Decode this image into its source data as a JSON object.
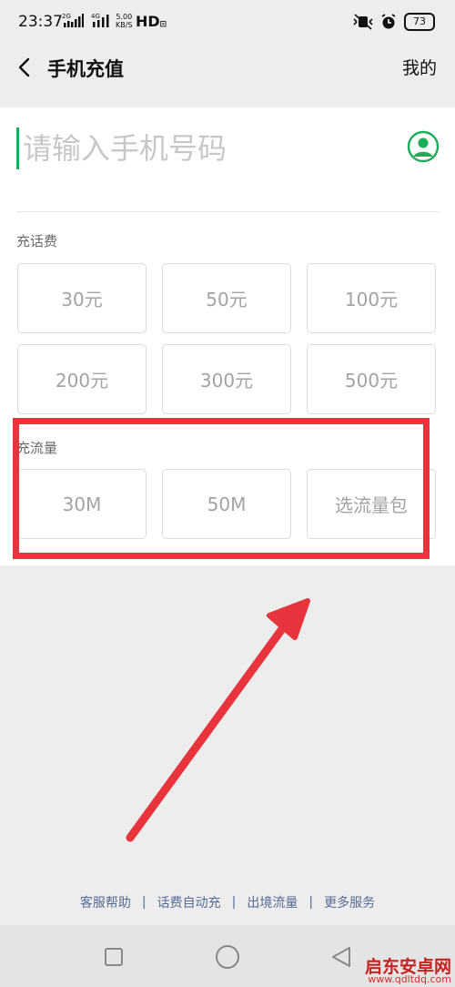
{
  "status_bar": {
    "time": "23:37",
    "signal1_label": "2G",
    "signal2_label": "4G",
    "speed_value": "5.00",
    "speed_unit": "KB/S",
    "hd_label": "HD",
    "battery": "73"
  },
  "header": {
    "title": "手机充值",
    "mine": "我的"
  },
  "phone": {
    "placeholder": "请输入手机号码"
  },
  "recharge": {
    "label": "充话费",
    "options": [
      "30元",
      "50元",
      "100元",
      "200元",
      "300元",
      "500元"
    ]
  },
  "data_plan": {
    "label": "充流量",
    "options": [
      "30M",
      "50M",
      "选流量包"
    ]
  },
  "footer": {
    "links": [
      "客服帮助",
      "话费自动充",
      "出境流量",
      "更多服务"
    ]
  },
  "watermark": {
    "brand": "启东安卓网",
    "url": "www.qdltdq.com"
  },
  "colors": {
    "accent_green": "#1aad5a",
    "annotation_red": "#e8343c",
    "link_blue": "#576b95"
  }
}
